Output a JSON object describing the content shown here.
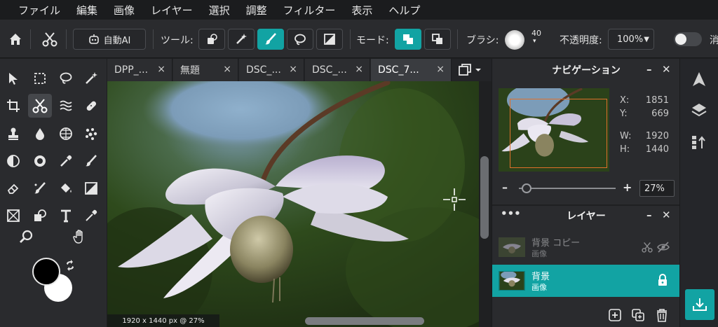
{
  "menu": [
    "ファイル",
    "編集",
    "画像",
    "レイヤー",
    "選択",
    "調整",
    "フィルター",
    "表示",
    "ヘルプ"
  ],
  "toolbar": {
    "ai_label": "自動AI",
    "tool_label": "ツール:",
    "mode_label": "モード:",
    "brush_label": "ブラシ:",
    "brush_size": "40",
    "opacity_label": "不透明度:",
    "opacity_value": "100%",
    "cutoff_label": "消"
  },
  "tabs": [
    {
      "label": "DPP_..."
    },
    {
      "label": "無題"
    },
    {
      "label": "DSC_..."
    },
    {
      "label": "DSC_..."
    },
    {
      "label": "DSC_7..."
    }
  ],
  "tab_close": "×",
  "status": "1920 x 1440 px @ 27%",
  "navigator": {
    "title": "ナビゲーション",
    "x_label": "X:",
    "x_value": "1851",
    "y_label": "Y:",
    "y_value": "669",
    "w_label": "W:",
    "w_value": "1920",
    "h_label": "H:",
    "h_value": "1440",
    "zoom": "27%",
    "zoom_fraction": 0.08
  },
  "layers": {
    "title": "レイヤー",
    "items": [
      {
        "name": "背景 コピー",
        "type": "画像",
        "active": false
      },
      {
        "name": "背景",
        "type": "画像",
        "active": true
      }
    ]
  },
  "colors": {
    "accent": "#12a3a3",
    "panel": "#2a2b2e",
    "nav_frame": "#e0702a"
  }
}
